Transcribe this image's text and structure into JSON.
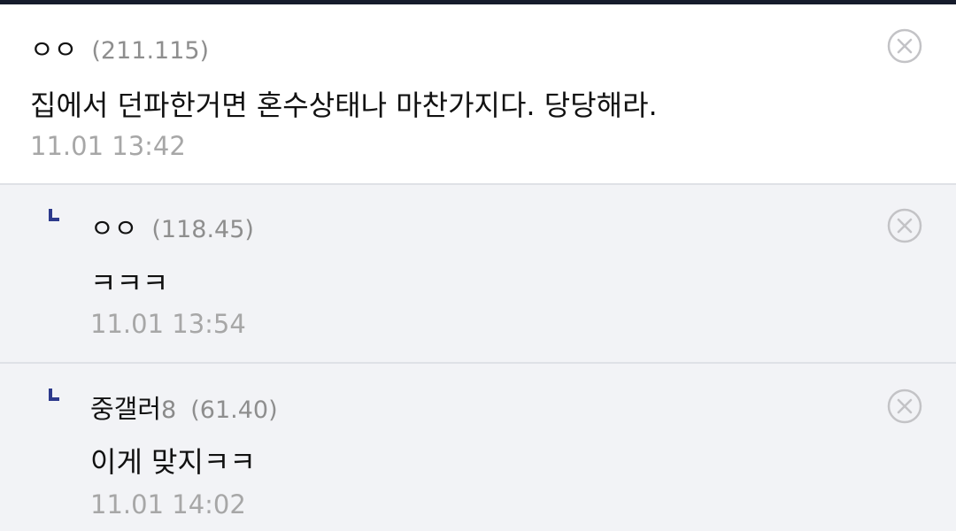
{
  "comments": [
    {
      "nickname": "ㅇㅇ",
      "ip": "(211.115)",
      "text": "집에서 던파한거면 혼수상태나 마찬가지다. 당당해라.",
      "time": "11.01 13:42",
      "is_reply": false
    },
    {
      "nickname": "ㅇㅇ",
      "ip": "(118.45)",
      "text": "ㅋㅋㅋ",
      "time": "11.01 13:54",
      "is_reply": true
    },
    {
      "nickname_main": "중갤러",
      "nickname_suffix": "8",
      "ip": "(61.40)",
      "text": "이게 맞지ㅋㅋ",
      "time": "11.01 14:02",
      "is_reply": true
    }
  ],
  "icons": {
    "reply": "reply-arrow-icon",
    "delete": "delete-x-circle-icon"
  },
  "colors": {
    "top_bar": "#161c2c",
    "reply_background": "#f2f3f6",
    "reply_icon": "#2d3a8c",
    "meta_text": "#a7a7a7"
  }
}
